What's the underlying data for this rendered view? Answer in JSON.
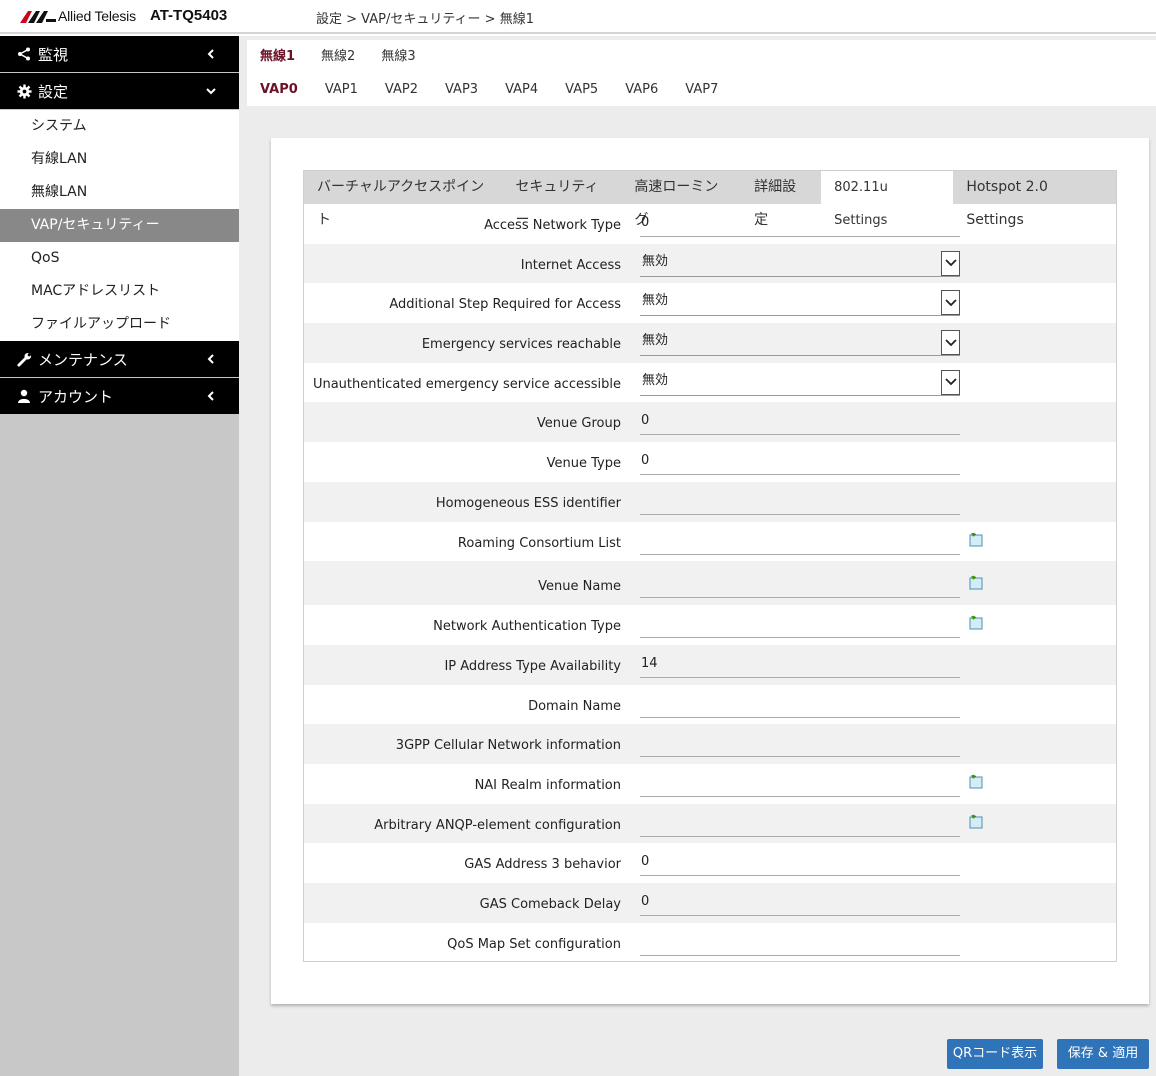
{
  "header": {
    "logo_text": "Allied Telesis",
    "model": "AT-TQ5403",
    "breadcrumb": "設定 > VAP/セキュリティー > 無線1"
  },
  "sidebar": {
    "monitor": "監視",
    "settings": "設定",
    "settings_items": [
      "システム",
      "有線LAN",
      "無線LAN",
      "VAP/セキュリティー",
      "QoS",
      "MACアドレスリスト",
      "ファイルアップロード"
    ],
    "maintenance": "メンテナンス",
    "account": "アカウント"
  },
  "radio_tabs": [
    "無線1",
    "無線2",
    "無線3"
  ],
  "vap_tabs": [
    "VAP0",
    "VAP1",
    "VAP2",
    "VAP3",
    "VAP4",
    "VAP5",
    "VAP6",
    "VAP7"
  ],
  "section_tabs": [
    "バーチャルアクセスポイント",
    "セキュリティー",
    "高速ローミング",
    "詳細設定",
    "802.11u Settings",
    "Hotspot 2.0 Settings"
  ],
  "form": {
    "rows": [
      {
        "label": "Access Network Type",
        "value": "0"
      },
      {
        "label": "Internet Access",
        "value": "無効"
      },
      {
        "label": "Additional Step Required for Access",
        "value": "無効"
      },
      {
        "label": "Emergency services reachable",
        "value": "無効"
      },
      {
        "label": "Unauthenticated emergency service accessible",
        "value": "無効"
      },
      {
        "label": "Venue Group",
        "value": "0"
      },
      {
        "label": "Venue Type",
        "value": "0"
      },
      {
        "label": "Homogeneous ESS identifier",
        "value": ""
      },
      {
        "label": "Roaming Consortium List",
        "value": ""
      },
      {
        "label": "Venue Name",
        "value": ""
      },
      {
        "label": "Network Authentication Type",
        "value": ""
      },
      {
        "label": "IP Address Type Availability",
        "value": "14"
      },
      {
        "label": "Domain Name",
        "value": ""
      },
      {
        "label": "3GPP Cellular Network information",
        "value": ""
      },
      {
        "label": "NAI Realm information",
        "value": ""
      },
      {
        "label": "Arbitrary ANQP-element configuration",
        "value": ""
      },
      {
        "label": "GAS Address 3 behavior",
        "value": "0"
      },
      {
        "label": "GAS Comeback Delay",
        "value": "0"
      },
      {
        "label": "QoS Map Set configuration",
        "value": ""
      }
    ]
  },
  "buttons": {
    "qr": "QRコード表示",
    "save": "保存 & 適用"
  },
  "colors": {
    "sidebar_head": "#000000",
    "active_tab": "#6b1227",
    "button": "#2f73b8",
    "logo_red": "#d0021b"
  }
}
